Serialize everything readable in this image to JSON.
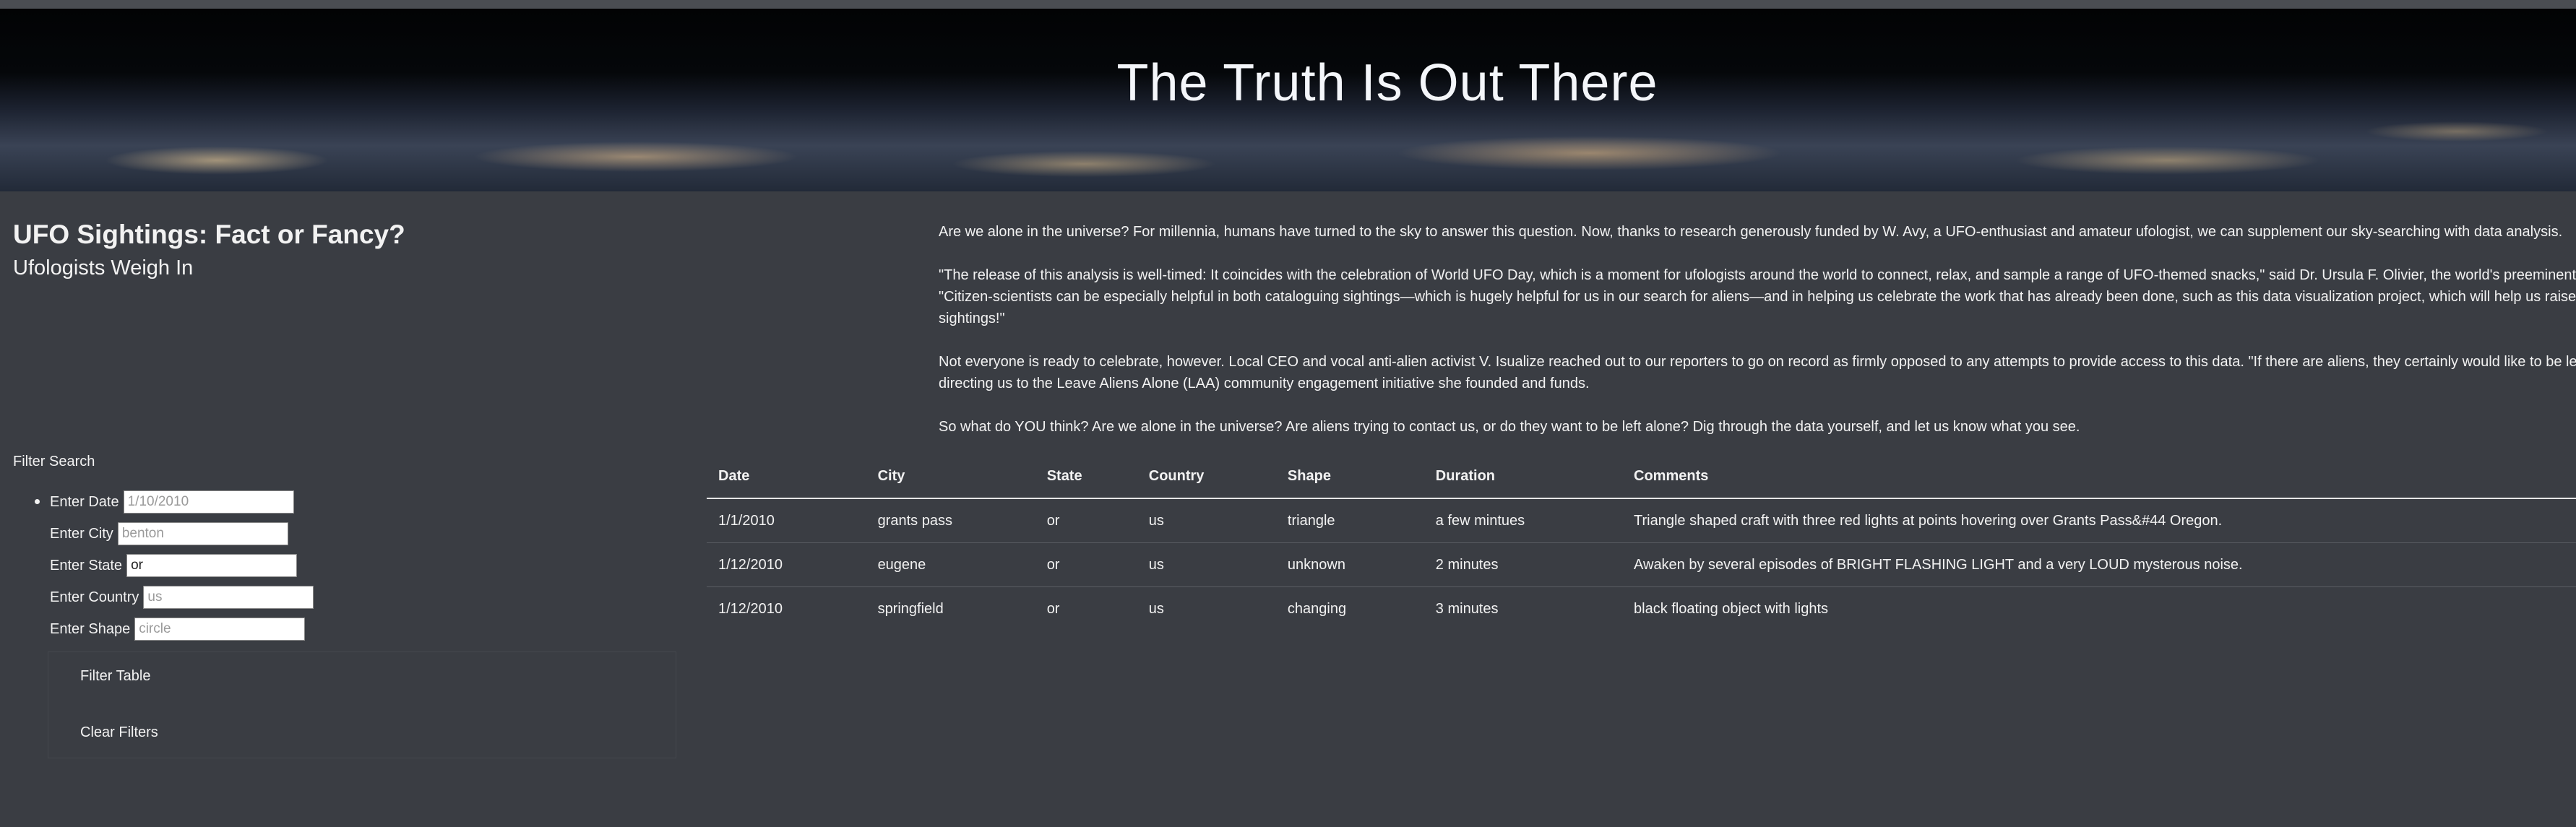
{
  "hero": {
    "title": "The Truth Is Out There"
  },
  "intro": {
    "title": "UFO Sightings: Fact or Fancy?",
    "subtitle": "Ufologists Weigh In"
  },
  "article": {
    "p1": "Are we alone in the universe? For millennia, humans have turned to the sky to answer this question. Now, thanks to research generously funded by W. Avy, a UFO-enthusiast and amateur ufologist, we can supplement our sky-searching with data analysis.",
    "p2_line1": "\"The release of this analysis is well-timed: It coincides with the celebration of World UFO Day, which is a moment for ufologists around the world to connect, relax, and sample a range of UFO-themed snacks,\" said Dr. Ursula F. Olivier, the world's preeminent e",
    "p2_line2": "\"Citizen-scientists can be especially helpful in both cataloguing sightings—which is hugely helpful for us in our search for aliens—and in helping us celebrate the work that has already been done, such as this data visualization project, which will help us raise a",
    "p2_line3": "sightings!\"",
    "p3_line1": "Not everyone is ready to celebrate, however. Local CEO and vocal anti-alien activist V. Isualize reached out to our reporters to go on record as firmly opposed to any attempts to provide access to this data. \"If there are aliens, they certainly would like to be lef",
    "p3_line2": "directing us to the Leave Aliens Alone (LAA) community engagement initiative she founded and funds.",
    "p4": "So what do YOU think? Are we alone in the universe? Are aliens trying to contact us, or do they want to be left alone? Dig through the data yourself, and let us know what you see."
  },
  "filters": {
    "heading": "Filter Search",
    "fields": [
      {
        "label": "Enter Date",
        "placeholder": "1/10/2010",
        "value": ""
      },
      {
        "label": "Enter City",
        "placeholder": "benton",
        "value": ""
      },
      {
        "label": "Enter State",
        "placeholder": "or",
        "value": "or"
      },
      {
        "label": "Enter Country",
        "placeholder": "us",
        "value": ""
      },
      {
        "label": "Enter Shape",
        "placeholder": "circle",
        "value": ""
      }
    ],
    "filter_button": "Filter Table",
    "clear_button": "Clear Filters"
  },
  "table": {
    "columns": [
      "Date",
      "City",
      "State",
      "Country",
      "Shape",
      "Duration",
      "Comments"
    ],
    "rows": [
      [
        "1/1/2010",
        "grants pass",
        "or",
        "us",
        "triangle",
        "a few mintues",
        "Triangle shaped craft with three red lights at points hovering over Grants Pass&#44 Oregon."
      ],
      [
        "1/12/2010",
        "eugene",
        "or",
        "us",
        "unknown",
        "2 minutes",
        "Awaken by several episodes of BRIGHT FLASHING LIGHT and a very LOUD mysterous noise."
      ],
      [
        "1/12/2010",
        "springfield",
        "or",
        "us",
        "changing",
        "3 minutes",
        "black floating object with lights"
      ]
    ]
  },
  "colors": {
    "background": "#3a3d43",
    "text": "#f2f2f2",
    "header_rule": "#e6e6e6"
  }
}
